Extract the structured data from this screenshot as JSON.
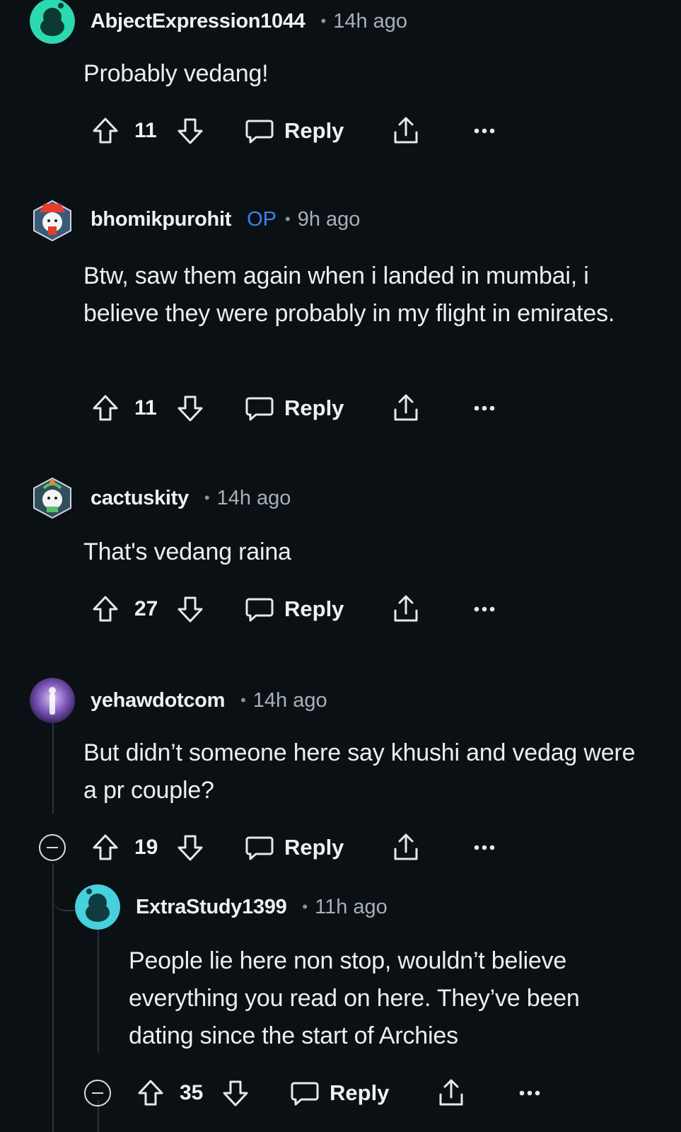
{
  "comments": [
    {
      "username": "AbjectExpression1044",
      "op": "",
      "time": "14h ago",
      "body": "Probably vedang!",
      "votes": "11",
      "reply_label": "Reply",
      "avatar_icon": "snoo-avatar-teal"
    },
    {
      "username": "bhomikpurohit",
      "op": "OP",
      "time": "9h ago",
      "body": "Btw, saw them again when i landed in mumbai, i believe they were probably in my flight in emirates.",
      "votes": "11",
      "reply_label": "Reply",
      "avatar_icon": "custom-avatar-red-hat"
    },
    {
      "username": "cactuskity",
      "op": "",
      "time": "14h ago",
      "body": "That's vedang raina",
      "votes": "27",
      "reply_label": "Reply",
      "avatar_icon": "custom-avatar-green"
    },
    {
      "username": "yehawdotcom",
      "op": "",
      "time": "14h ago",
      "body": "But didn’t someone here say khushi and vedag were a pr couple?",
      "votes": "19",
      "reply_label": "Reply",
      "avatar_icon": "image-avatar-purple"
    },
    {
      "username": "ExtraStudy1399",
      "op": "",
      "time": "11h ago",
      "body": "People lie here non stop, wouldn’t believe everything you read on here. They’ve been dating since the start of Archies",
      "votes": "35",
      "reply_label": "Reply",
      "avatar_icon": "snoo-avatar-cyan"
    }
  ],
  "colors": {
    "background": "#0b1015",
    "op_badge": "#3b82f6",
    "meta_gray": "#a8b0b8",
    "thread_line": "#2c333a"
  }
}
